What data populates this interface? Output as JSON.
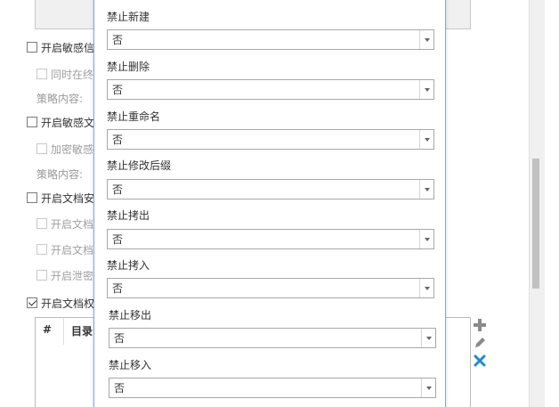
{
  "background": {
    "options": [
      {
        "label": "开启敏感信",
        "checked": false,
        "disabled": false
      },
      {
        "label": "同时在终",
        "checked": false,
        "disabled": true
      },
      {
        "label": "开启敏感文",
        "checked": false,
        "disabled": false
      },
      {
        "label": "加密敏感",
        "checked": false,
        "disabled": true
      },
      {
        "label": "开启文档安",
        "checked": false,
        "disabled": false
      },
      {
        "label": "开启文档",
        "checked": false,
        "disabled": true
      },
      {
        "label": "开启文档",
        "checked": false,
        "disabled": true
      },
      {
        "label": "开启泄密",
        "checked": false,
        "disabled": true
      },
      {
        "label": "开启文档权",
        "checked": true,
        "disabled": false
      }
    ],
    "strategy_label": "策略内容:",
    "table": {
      "col_index": "#",
      "col_dir": "目录"
    },
    "tools": {
      "add_icon": "plus-icon",
      "edit_icon": "pencil-icon",
      "delete_icon": "close-icon",
      "delete_color": "#1a8bd6"
    }
  },
  "dialog": {
    "fields": [
      {
        "label": "禁止新建",
        "value": "否"
      },
      {
        "label": "禁止删除",
        "value": "否"
      },
      {
        "label": "禁止重命名",
        "value": "否"
      },
      {
        "label": "禁止修改后缀",
        "value": "否"
      },
      {
        "label": "禁止拷出",
        "value": "否"
      },
      {
        "label": "禁止拷入",
        "value": "否"
      },
      {
        "label": "禁止移出",
        "value": "否"
      },
      {
        "label": "禁止移入",
        "value": "否"
      }
    ]
  }
}
